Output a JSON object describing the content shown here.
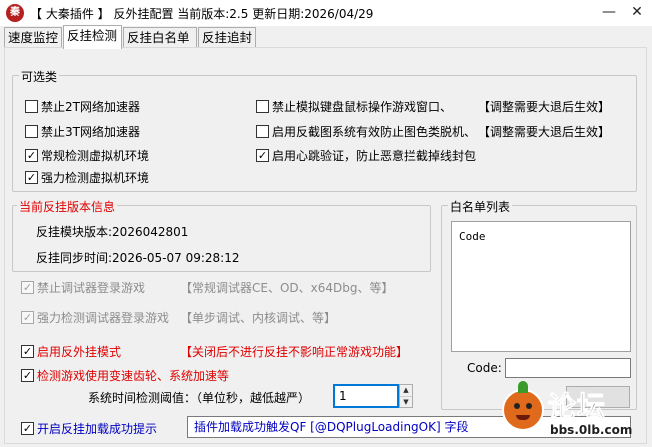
{
  "window": {
    "logo_text": "秦",
    "title": "【 大秦插件 】 反外挂配置  当前版本:2.5  更新日期:2026/04/29",
    "minimize_glyph": "—",
    "close_glyph": "✕"
  },
  "tabs": [
    {
      "label": "速度监控",
      "active": false
    },
    {
      "label": "反挂检测",
      "active": true
    },
    {
      "label": "反挂白名单",
      "active": false
    },
    {
      "label": "反挂追封",
      "active": false
    }
  ],
  "options": {
    "group_title": "可选类",
    "block_2t": {
      "label": "禁止2T网络加速器",
      "checked": false
    },
    "block_3t": {
      "label": "禁止3T网络加速器",
      "checked": false
    },
    "vm_normal": {
      "label": "常规检测虚拟机环境",
      "checked": true
    },
    "vm_strong": {
      "label": "强力检测虚拟机环境",
      "checked": true
    },
    "block_sim_input": {
      "label": "禁止模拟键盘鼠标操作游戏窗口、",
      "checked": false,
      "note": "【调整需要大退后生效】"
    },
    "anti_screenshot": {
      "label": "启用反截图系统有效防止图色类脱机、",
      "checked": false,
      "note": "【调整需要大退后生效】"
    },
    "heartbeat": {
      "label": "启用心跳验证，防止恶意拦截掉线封包",
      "checked": true
    }
  },
  "version_info": {
    "group_title": "当前反挂版本信息",
    "module_version": "反挂模块版本:2026042801",
    "sync_time": "反挂同步时间:2026-05-07 09:28:12"
  },
  "debugger": {
    "block_login": {
      "label": "禁止调试器登录游戏",
      "checked": true,
      "note": "【常规调试器CE、OD、x64Dbg、等】",
      "enabled": false
    },
    "strong_detect": {
      "label": "强力检测调试器登录游戏",
      "checked": true,
      "note": "【单步调试、内核调试、等】",
      "enabled": false
    }
  },
  "anticheat_mode": {
    "label": "启用反外挂模式",
    "checked": true,
    "note": "【关闭后不进行反挂不影响正常游戏功能】"
  },
  "speed_detect": {
    "label": "检测游戏使用变速齿轮、系统加速等",
    "checked": true
  },
  "threshold": {
    "label": "系统时间检测阈值：（单位秒，越低越严）",
    "value": "1"
  },
  "load_prompt": {
    "label": "开启反挂加载成功提示",
    "checked": true,
    "text": "插件加载成功触发QF [@DQPlugLoadingOK] 字段"
  },
  "whitelist": {
    "group_title": "白名单列表",
    "items": [
      "Code"
    ],
    "code_label": "Code:",
    "code_value": ""
  },
  "watermark": {
    "logo": "论坛",
    "site": "bbs.0lb.com"
  },
  "colors": {
    "red_text": "#e00000",
    "link_blue": "#0000c0",
    "focus_blue": "#0078d7"
  }
}
